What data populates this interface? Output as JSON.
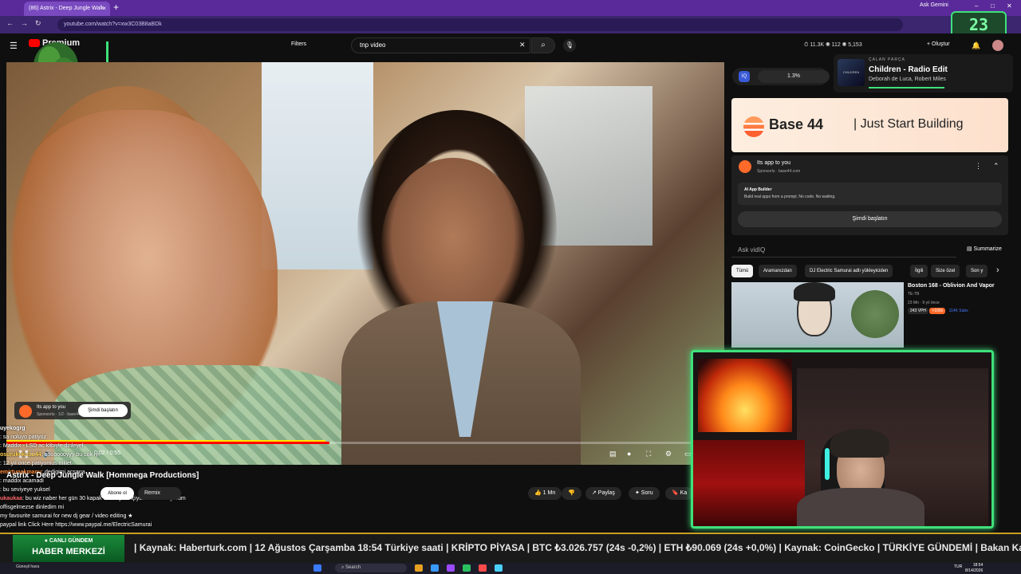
{
  "browser": {
    "tab_title": "(86) Astrix - Deep Jungle Walk",
    "tab_close": "×",
    "new_tab": "+",
    "ask_gemini": "Ask Gemini",
    "url": "youtube.com/watch?v=xw3C03B8aBDk",
    "nav": {
      "back": "←",
      "forward": "→",
      "reload": "↻"
    },
    "window": {
      "min": "–",
      "max": "□",
      "close": "✕"
    }
  },
  "overlay_counter": "23",
  "youtube": {
    "logo": "Premium",
    "filters": "Filters",
    "search_value": "tnp video",
    "clear": "✕",
    "search_icon": "⌕",
    "mic": "🎙",
    "stats": "⏱ 11.3K  ◉ 112  ◉ 5,153",
    "create": "+ Oluştur"
  },
  "player": {
    "time": "0:02 / 0:55",
    "controls": [
      "❚❚",
      "⏭",
      "🔊"
    ],
    "right_controls": [
      "▤",
      "●",
      "⛶",
      "⚙",
      "▭"
    ]
  },
  "ad_overlay": {
    "title": "Its app to you",
    "sub": "Sponsorlu · 1/2 · base44.com",
    "button": "Şimdi başlatın"
  },
  "chat": [
    {
      "user": "uyekogrg",
      "text": "",
      "color": "#ffffff"
    },
    {
      "user": "",
      "text": ": sa noluyo patiyoz",
      "color": "#ff5a5a"
    },
    {
      "user": "",
      "text": ": Maddix - LSD ac klibiyle dinleyel",
      "color": "#ff5ad0"
    },
    {
      "user": "osurukokusu44",
      "text": ": oooooooyyy bu cok iyı",
      "color": "#ffd04a"
    },
    {
      "user": "",
      "text": ": 12 yıl once patiyomus millet",
      "color": "#5ad0ff"
    },
    {
      "user": "emirtunakmanu",
      "text": ": dedigimi acsana",
      "color": "#ff8a3a"
    },
    {
      "user": "",
      "text": ": maddix acamadi",
      "color": "#ff5a5a"
    },
    {
      "user": "",
      "text": ": bu seviyeye yuksel",
      "color": "#5affa0"
    },
    {
      "user": "ukaukaa",
      "text": ": bu wiz naber her gün 30 kapak 10-15 joint içiyor merak ediyorum",
      "color": "#ff6a6a"
    },
    {
      "user": "",
      "text": "  offisgelmezse dinledim mi",
      "color": "#aaaaaa"
    },
    {
      "user": "",
      "text": "my favourite samurai  for new dj gear / video editing ★",
      "color": "#ffffff"
    },
    {
      "user": "",
      "text": "paypal link  Click Here  https://www.paypal.me/ElectricSamurai",
      "color": "#8ab4ff"
    }
  ],
  "video_title": "Astrix - Deep Jungle Walk [Hommega Productions]",
  "subscribe": "Abone ol",
  "remix": "Remix",
  "actions": {
    "like": "👍 1 Mn",
    "dislike": "👎",
    "share": "↗ Paylaş",
    "ask": "✦ Soru",
    "save": "🔖 Ka"
  },
  "vidiq": {
    "logo": "IQ",
    "pct": "1.3%"
  },
  "now_playing": {
    "label": "ÇALAN PARÇA",
    "title": "Children - Radio Edit",
    "artist": "Deborah de Luca, Robert Miles",
    "art": "CHILDREN"
  },
  "sidebar_ad": {
    "banner_brand": "Base 44",
    "banner_tag": "|  Just Start Building",
    "card_title": "Its app to you",
    "card_sub": "Sponsorlu · base44.com",
    "box_title": "AI App Builder",
    "box_sub": "Build real apps from a prompt. No code. No waiting.",
    "cta": "Şimdi başlatın",
    "more": "⋮",
    "collapse": "⌃"
  },
  "ask_vidiq": "Ask vidIQ",
  "summarize": "▤ Summarize",
  "chips": [
    "Tümü",
    "Aramanızdan",
    "DJ Electric Samurai adlı yükleyiciden",
    "İlgili",
    "Size özel",
    "Son y"
  ],
  "chips_next": "›",
  "related": {
    "title": "Boston 168 - Oblivion And Vapor",
    "channel": "TE-TB",
    "meta": "23 Mn · 9 yıl önce",
    "badges": [
      "243 VPH",
      "×100x",
      "114K Subs"
    ]
  },
  "ticker": {
    "live": "● CANLI GÜNDEM",
    "main": "HABER MERKEZİ",
    "text": "| Kaynak: Haberturk.com | 12 Ağustos Çarşamba 18:54 Türkiye saati | KRİPTO PİYASA | BTC ₺3.026.757 (24s -0,2%) | ETH ₺90.069 (24s +0,0%) | Kaynak: CoinGecko | TÜRKİYE GÜNDEMİ | Bakan Kacır: Daha"
  },
  "taskbar": {
    "weather": "Güneşli hava",
    "search": "⌕ Search",
    "lang": "TUR",
    "time": "18:54",
    "date": "8/14/2026"
  },
  "colors": {
    "accent_green": "#3fe07a",
    "yt_red": "#ff0000",
    "vidiq_blue": "#3a5bd9"
  }
}
